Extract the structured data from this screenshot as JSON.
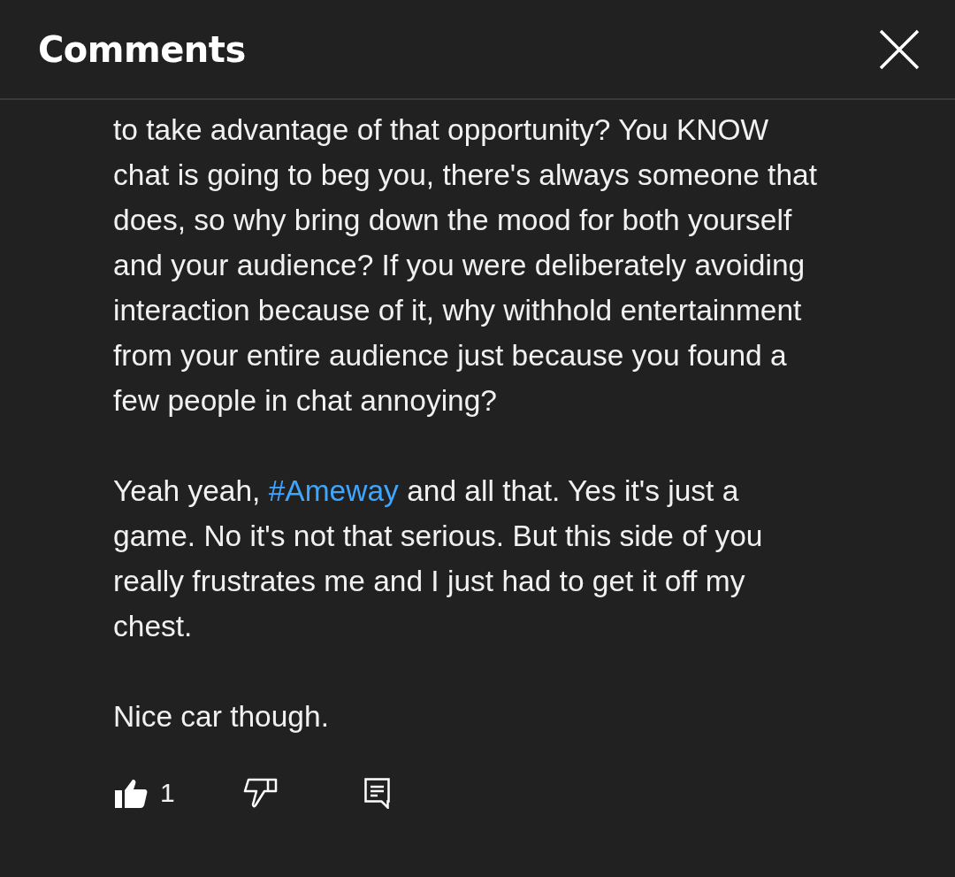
{
  "header": {
    "title": "Comments"
  },
  "comment": {
    "paragraphs": [
      [
        {
          "text": "to take advantage of that opportunity? You KNOW\nchat is going to beg you, there's always someone that\ndoes, so why bring down the mood for both yourself\nand your audience? If you were deliberately avoiding\ninteraction because of it, why withhold entertainment\nfrom your entire audience just because you found a\nfew people in chat annoying?"
        }
      ],
      [
        {
          "text": "Yeah yeah, "
        },
        {
          "text": "#Ameway",
          "kind": "hashtag"
        },
        {
          "text": " and all that. Yes it's just a\ngame. No it's not that serious. But this side of you\nreally frustrates me and I just had to get it off my\nchest."
        }
      ],
      [
        {
          "text": "Nice car though."
        }
      ]
    ],
    "likes": "1"
  }
}
